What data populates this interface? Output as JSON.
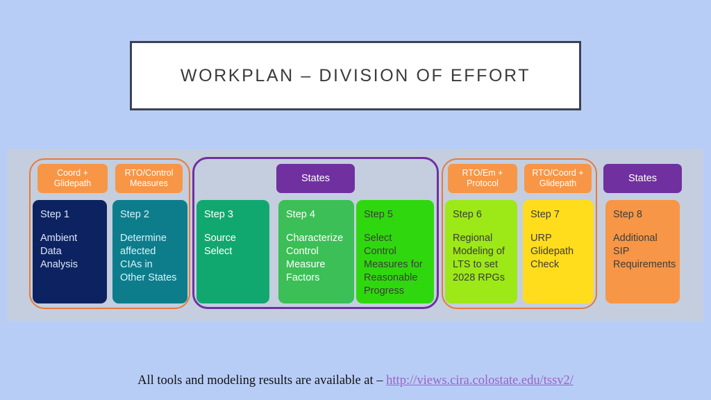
{
  "slide": {
    "title": "WORKPLAN – DIVISION OF EFFORT",
    "background_color": "#b8cdf6",
    "panel_color": "#c4cedf"
  },
  "headers": [
    {
      "label": "Coord + Glidepath",
      "color": "#f79646",
      "text_color": "#ffffff"
    },
    {
      "label": "RTO/Control Measures",
      "color": "#f79646",
      "text_color": "#ffffff"
    },
    {
      "label": "States",
      "color": "#7030a0",
      "text_color": "#ffffff"
    },
    {
      "label": "RTO/Em + Protocol",
      "color": "#f79646",
      "text_color": "#ffffff"
    },
    {
      "label": "RTO/Coord + Glidepath",
      "color": "#f79646",
      "text_color": "#ffffff"
    },
    {
      "label": "States",
      "color": "#7030a0",
      "text_color": "#ffffff"
    }
  ],
  "steps": [
    {
      "number": "Step 1",
      "description": "Ambient Data Analysis",
      "color": "#0d2361",
      "text_color": "#dce6f7"
    },
    {
      "number": "Step 2",
      "description": "Determine affected CIAs in Other States",
      "color": "#0d7d8c",
      "text_color": "#d8f4f7"
    },
    {
      "number": "Step 3",
      "description": "Source Select",
      "color": "#11a86f",
      "text_color": "#ffffff"
    },
    {
      "number": "Step 4",
      "description": "Characterize Control Measure Factors",
      "color": "#3cbf57",
      "text_color": "#ffffff"
    },
    {
      "number": "Step 5",
      "description": "Select Control Measures for Reasonable Progress",
      "color": "#2fd80e",
      "text_color": "#3c3c3c"
    },
    {
      "number": "Step 6",
      "description": "Regional Modeling of LTS to set 2028 RPGs",
      "color": "#9de817",
      "text_color": "#3c3c3c"
    },
    {
      "number": "Step 7",
      "description": "URP Glidepath Check",
      "color": "#ffdd1c",
      "text_color": "#3c3c3c"
    },
    {
      "number": "Step 8",
      "description": "Additional SIP Requirements",
      "color": "#f79646",
      "text_color": "#3c3c3c"
    }
  ],
  "groups": [
    {
      "name": "group-steps-1-2",
      "border_color": "#e8793a"
    },
    {
      "name": "group-steps-3-5",
      "border_color": "#7030a0"
    },
    {
      "name": "group-steps-6-7",
      "border_color": "#e8793a"
    }
  ],
  "footer": {
    "text": "All tools and modeling results are available at – ",
    "link_text": "http://views.cira.colostate.edu/tssv2/",
    "link_color": "#9a62c8"
  }
}
